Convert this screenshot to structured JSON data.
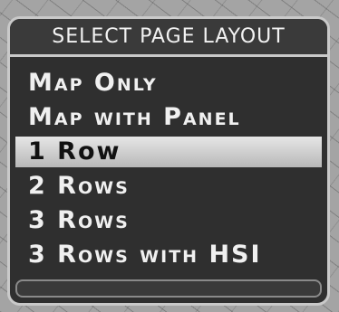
{
  "dialog": {
    "title": "SELECT PAGE LAYOUT",
    "items": [
      {
        "label": "Map Only",
        "selected": false
      },
      {
        "label": "Map with Panel",
        "selected": false
      },
      {
        "label": "1 Row",
        "selected": true
      },
      {
        "label": "2 Rows",
        "selected": false
      },
      {
        "label": "3 Rows",
        "selected": false
      },
      {
        "label": "3 Rows with HSI",
        "selected": false
      }
    ]
  }
}
